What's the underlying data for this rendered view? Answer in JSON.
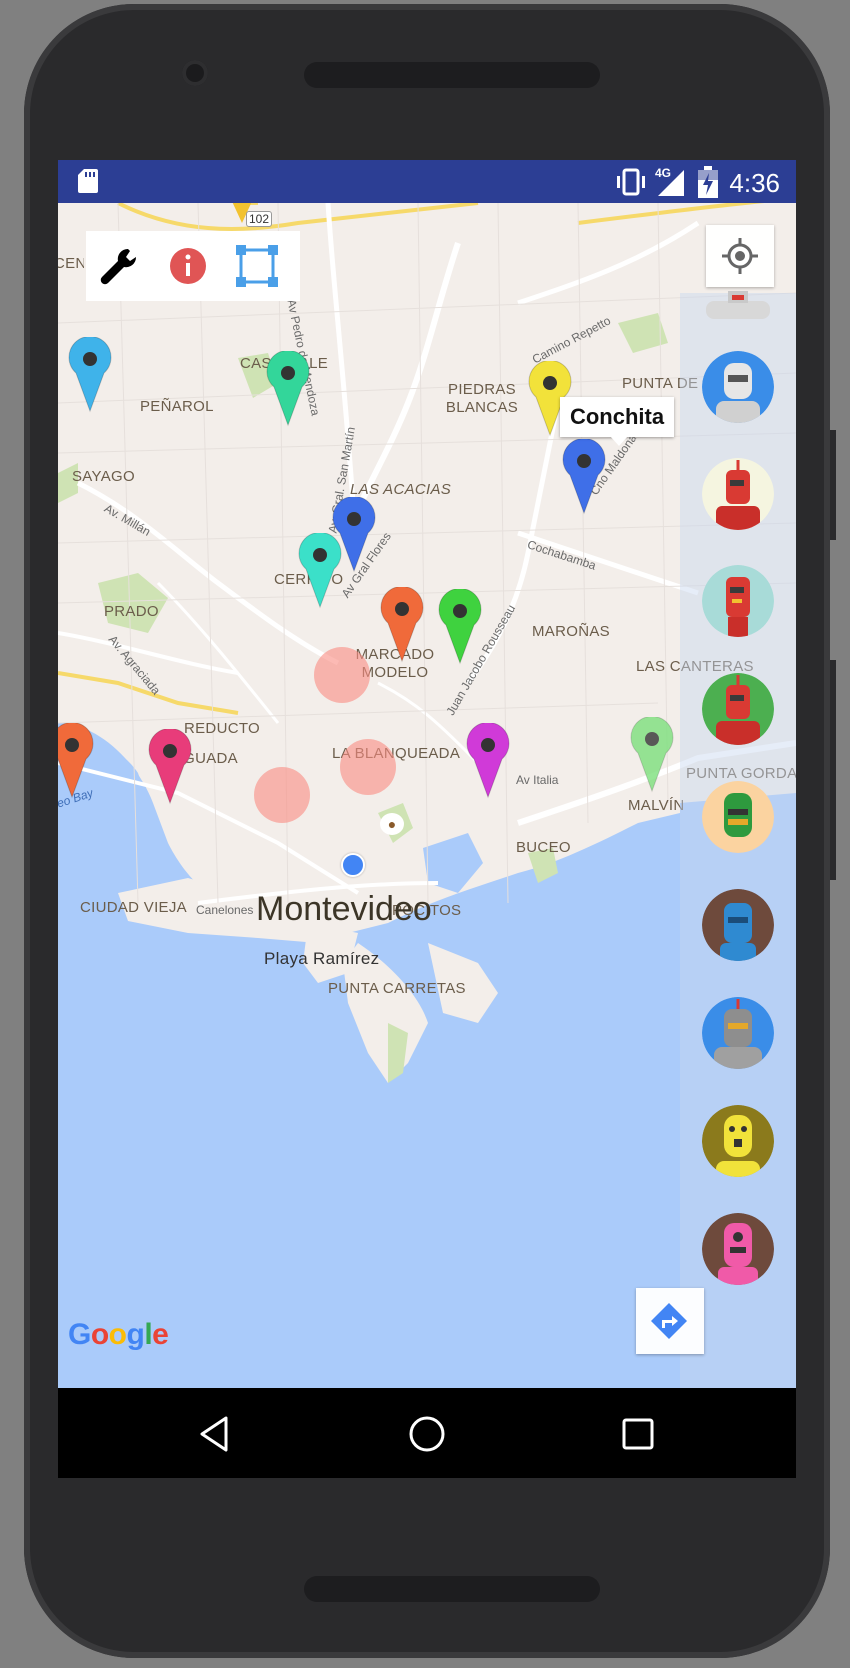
{
  "status_bar": {
    "time": "4:36",
    "network_label": "4G",
    "icons": [
      "sd-card-icon",
      "vibrate-icon",
      "signal-icon",
      "battery-icon"
    ]
  },
  "toolbar": {
    "icons": [
      "wrench-icon",
      "info-icon",
      "select-area-icon"
    ],
    "info_color": "#e05555",
    "select_color": "#4a9fe8"
  },
  "map": {
    "city": "Montevideo",
    "route_shield": "102",
    "neighborhoods": [
      {
        "text": "CENTRO",
        "key": "cen"
      },
      {
        "text": "CASAVALLE",
        "key": "casavalle"
      },
      {
        "text": "PEÑAROL",
        "key": "penarol"
      },
      {
        "text": "PIEDRAS BLANCAS",
        "key": "piedras"
      },
      {
        "text": "PUNTA DE RIELES",
        "key": "punta_rieles"
      },
      {
        "text": "SAYAGO",
        "key": "sayago"
      },
      {
        "text": "LAS ACACIAS",
        "key": "acacias"
      },
      {
        "text": "CERRITO",
        "key": "cerrito"
      },
      {
        "text": "PRADO",
        "key": "prado"
      },
      {
        "text": "MARCADO MODELO",
        "key": "mercado"
      },
      {
        "text": "MAROÑAS",
        "key": "maronas"
      },
      {
        "text": "LAS CANTERAS",
        "key": "canteras"
      },
      {
        "text": "REDUCTO",
        "key": "reducto"
      },
      {
        "text": "AGUADA",
        "key": "aguada"
      },
      {
        "text": "LA BLANQUEADA",
        "key": "blanqueada"
      },
      {
        "text": "PUNTA GORDA",
        "key": "punta_gorda"
      },
      {
        "text": "MALVÍN",
        "key": "malvin"
      },
      {
        "text": "BUCEO",
        "key": "buceo"
      },
      {
        "text": "CIUDAD VIEJA",
        "key": "ciudad_vieja"
      },
      {
        "text": "POCITOS",
        "key": "pocitos"
      },
      {
        "text": "Playa Ramírez",
        "key": "playa"
      },
      {
        "text": "PUNTA CARRETAS",
        "key": "punta_carretas"
      }
    ],
    "streets": [
      "Av Pedro de Mendoza",
      "Camino Repetto",
      "Av. Gral. San Martín",
      "Av. Millán",
      "Av Gral Flores",
      "Cochabamba",
      "Av. Agraciada",
      "Juan Jacobo Rousseau",
      "Av Italia",
      "Canelones",
      "Cno Maldonado",
      "Montevideo Bay"
    ],
    "info_window": "Conchita",
    "markers": [
      {
        "name": "marker-light-blue",
        "color": "#3fb3ea"
      },
      {
        "name": "marker-teal-green",
        "color": "#33d69a"
      },
      {
        "name": "marker-yellow",
        "color": "#f2e23a"
      },
      {
        "name": "marker-blue-conchita",
        "color": "#3f6fe8"
      },
      {
        "name": "marker-blue",
        "color": "#3f6fe8"
      },
      {
        "name": "marker-cyan",
        "color": "#3be0c9"
      },
      {
        "name": "marker-orange",
        "color": "#f06a3a"
      },
      {
        "name": "marker-green",
        "color": "#3fd23f"
      },
      {
        "name": "marker-orange-west",
        "color": "#f06a3a"
      },
      {
        "name": "marker-pink",
        "color": "#e83c7a"
      },
      {
        "name": "marker-magenta",
        "color": "#d03ad8"
      },
      {
        "name": "marker-light-green",
        "color": "#7de07d"
      }
    ],
    "google": [
      "G",
      "o",
      "o",
      "g",
      "l",
      "e"
    ]
  },
  "avatars": [
    {
      "name": "robot-avatar-white",
      "bg": "#3a8de8",
      "robot": "#e6e6e6"
    },
    {
      "name": "robot-avatar-red",
      "bg": "#f5f5e0",
      "robot": "#d93a33"
    },
    {
      "name": "robot-avatar-red-teal",
      "bg": "#a8dbd8",
      "robot": "#d93a33"
    },
    {
      "name": "robot-avatar-red-green",
      "bg": "#4caf50",
      "robot": "#d93a33"
    },
    {
      "name": "robot-avatar-green",
      "bg": "#fbd3a0",
      "robot": "#2e9a3e"
    },
    {
      "name": "robot-avatar-blue",
      "bg": "#6e4a3c",
      "robot": "#2f8ad1"
    },
    {
      "name": "robot-avatar-grey",
      "bg": "#3a8de8",
      "robot": "#8e8e8e"
    },
    {
      "name": "robot-avatar-yellow",
      "bg": "#8b7a1c",
      "robot": "#f1e23a"
    },
    {
      "name": "robot-avatar-pink",
      "bg": "#6e4a3c",
      "robot": "#f05aa8"
    }
  ]
}
